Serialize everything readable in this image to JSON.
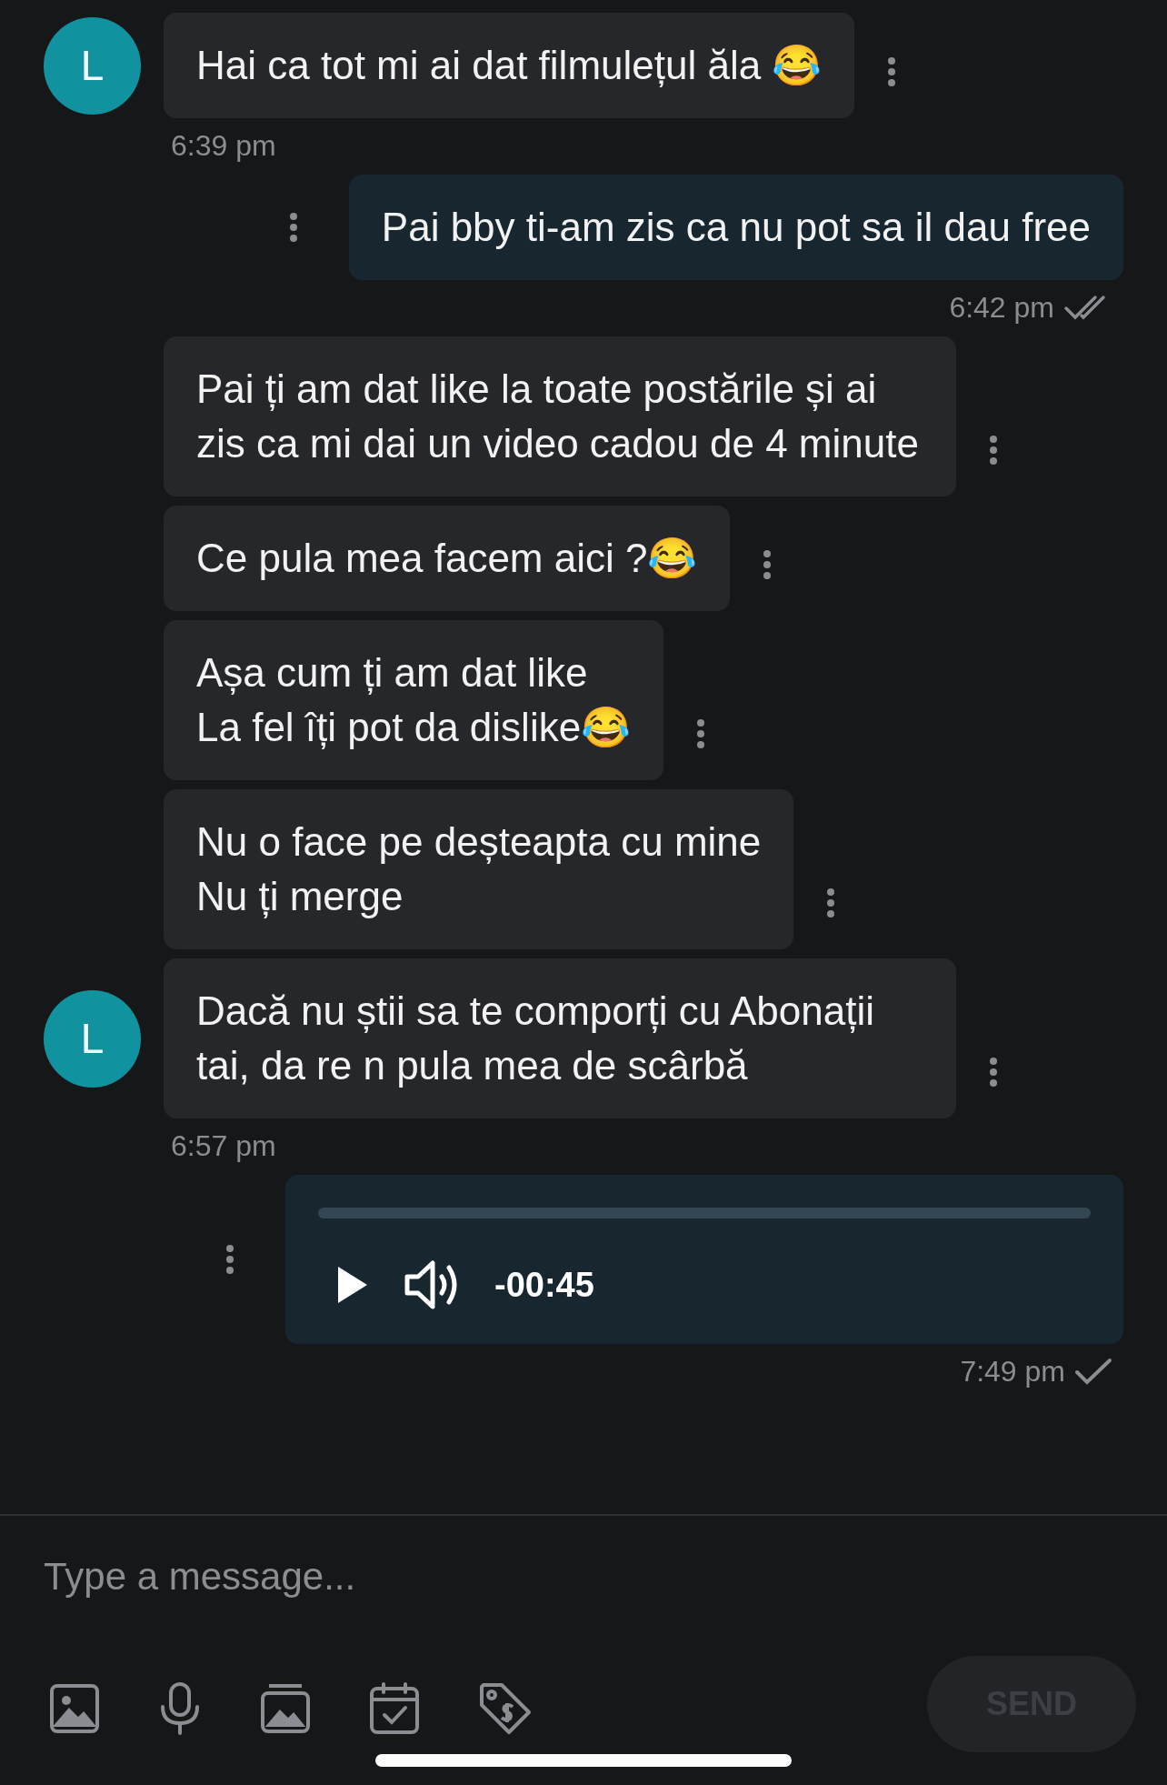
{
  "messages": [
    {
      "kind": "incoming",
      "avatar": "L",
      "text": "Hai ca tot mi ai dat filmulețul ăla 😂",
      "time": "6:39 pm"
    },
    {
      "kind": "outgoing",
      "text": "Pai bby ti-am zis ca nu pot sa il dau free",
      "time": "6:42 pm",
      "read": true
    },
    {
      "kind": "incoming",
      "text": "Pai ți am dat like la toate postările și ai zis ca mi dai un video cadou de 4 minute"
    },
    {
      "kind": "incoming",
      "text": "Ce pula mea facem aici ?😂"
    },
    {
      "kind": "incoming",
      "text": "Așa cum ți am dat like\nLa fel îți pot da dislike😂"
    },
    {
      "kind": "incoming",
      "text": "Nu o face pe deșteapta cu mine\nNu ți merge"
    },
    {
      "kind": "incoming",
      "avatar": "L",
      "text": "Dacă nu știi sa te comporți cu Abonații tai, da re n pula mea de scârbă",
      "time": "6:57 pm"
    },
    {
      "kind": "audio",
      "duration": "-00:45",
      "level": 0,
      "time": "7:49 pm",
      "read": false
    }
  ],
  "composer": {
    "placeholder": "Type a message..."
  },
  "send_button": {
    "label": "SEND",
    "disabled": true
  }
}
